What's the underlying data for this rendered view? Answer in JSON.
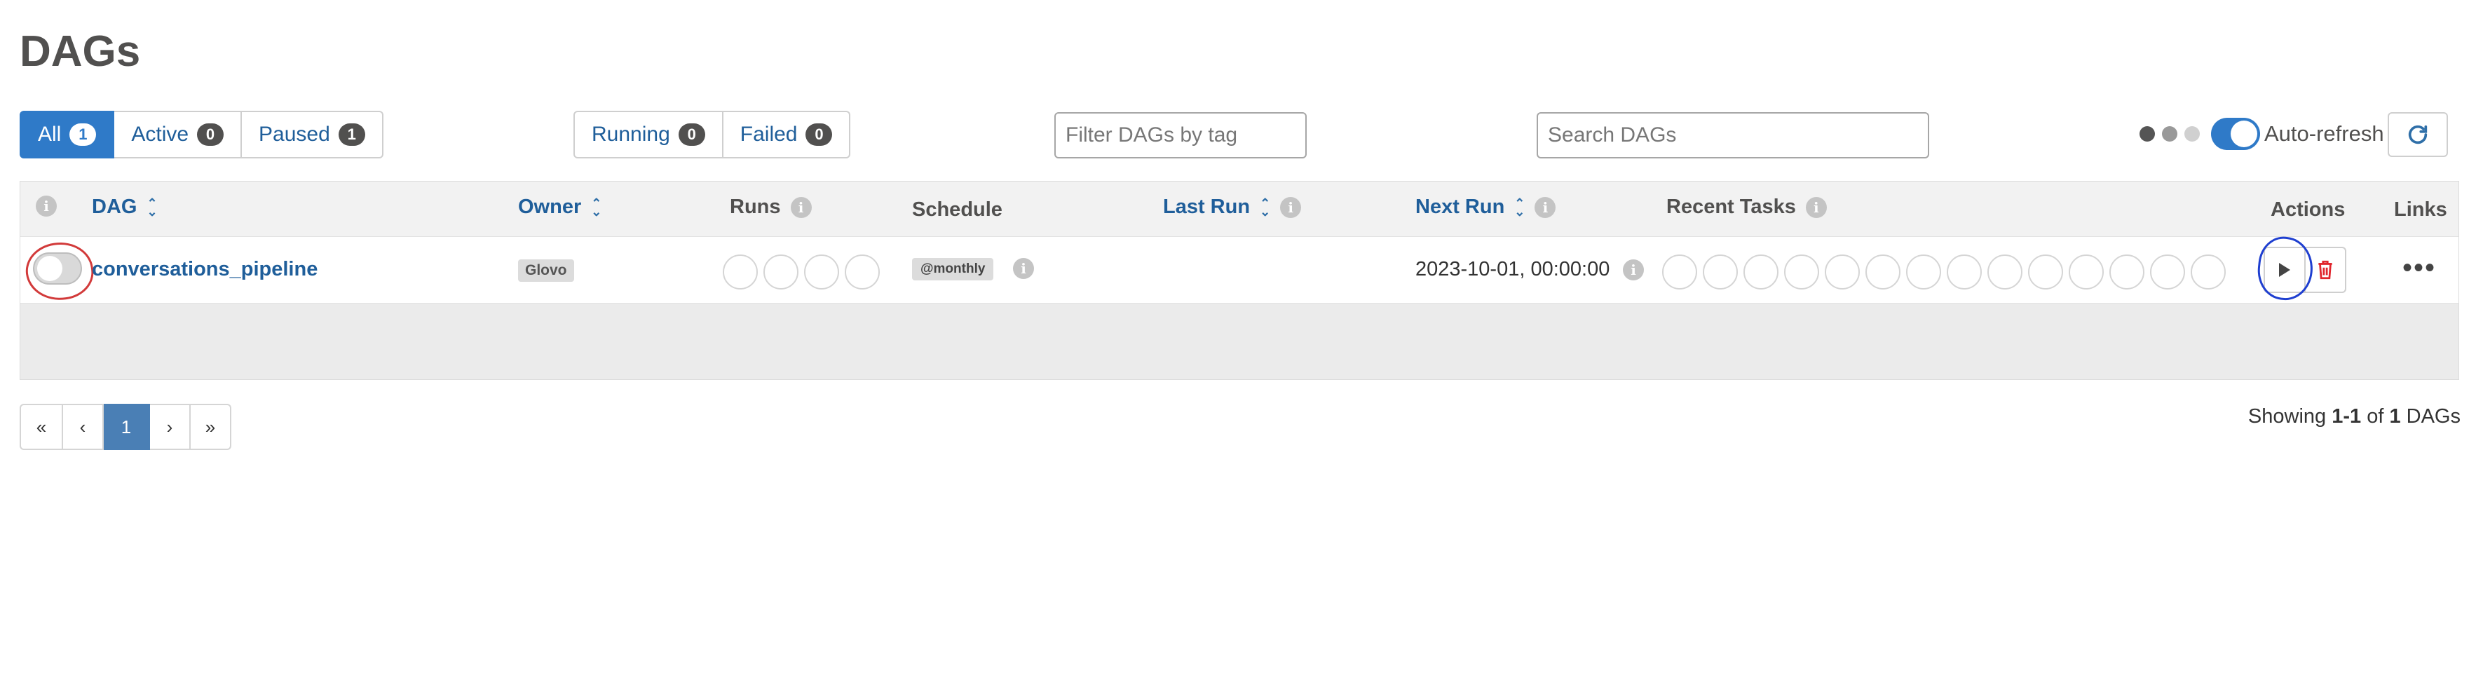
{
  "page": {
    "title": "DAGs"
  },
  "status_tabs": [
    {
      "label": "All",
      "count": "1",
      "active": true
    },
    {
      "label": "Active",
      "count": "0",
      "active": false
    },
    {
      "label": "Paused",
      "count": "1",
      "active": false
    }
  ],
  "run_tabs": [
    {
      "label": "Running",
      "count": "0"
    },
    {
      "label": "Failed",
      "count": "0"
    }
  ],
  "filters": {
    "tag_placeholder": "Filter DAGs by tag",
    "search_placeholder": "Search DAGs"
  },
  "auto_refresh": {
    "label": "Auto-refresh",
    "enabled": true
  },
  "table": {
    "headers": {
      "dag": "DAG",
      "owner": "Owner",
      "runs": "Runs",
      "schedule": "Schedule",
      "last_run": "Last Run",
      "next_run": "Next Run",
      "recent_tasks": "Recent Tasks",
      "actions": "Actions",
      "links": "Links"
    },
    "rows": [
      {
        "paused": true,
        "dag_id": "conversations_pipeline",
        "owner": "Glovo",
        "runs_circles": 4,
        "schedule": "@monthly",
        "last_run": "",
        "next_run": "2023-10-01, 00:00:00",
        "recent_task_circles": 14
      }
    ]
  },
  "pagination": {
    "first": "«",
    "prev": "‹",
    "current": "1",
    "next": "›",
    "last": "»"
  },
  "showing": {
    "prefix": "Showing ",
    "range": "1-1",
    "of": " of ",
    "total": "1",
    "suffix": " DAGs"
  },
  "colors": {
    "primary": "#2f7ac8",
    "link": "#1f5e9a",
    "delete": "#e0262d",
    "annotation_red": "#d23a3a",
    "annotation_blue": "#1f3fd0"
  }
}
